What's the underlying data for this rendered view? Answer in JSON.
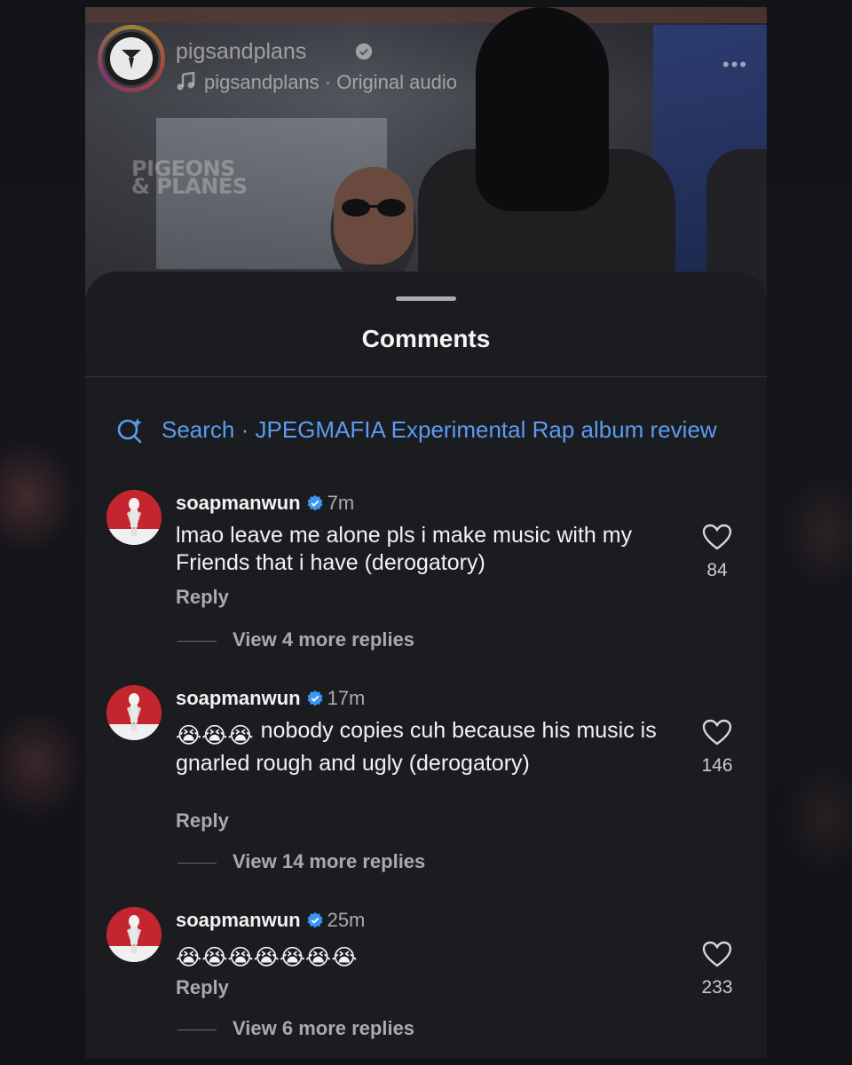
{
  "video": {
    "account": "pigsandplans",
    "audio": "pigsandplans · Original audio",
    "watermark_line1": "PIGEONS",
    "watermark_line2": "& PLANES",
    "more": "•••"
  },
  "sheet": {
    "title": "Comments",
    "search_prefix": "Search",
    "search_separator": " · ",
    "search_query": "JPEGMAFIA Experimental Rap album review"
  },
  "comments": [
    {
      "username": "soapmanwun",
      "time": "7m",
      "text": "lmao leave me alone pls i make music with my Friends that i have (derogatory)",
      "reply": "Reply",
      "view_replies": "View 4 more replies",
      "likes": "84"
    },
    {
      "username": "soapmanwun",
      "time": "17m",
      "emojis": "😭😭😭",
      "text": "nobody copies cuh because his music is gnarled rough and ugly (derogatory)",
      "reply": "Reply",
      "view_replies": "View 14 more replies",
      "likes": "146"
    },
    {
      "username": "soapmanwun",
      "time": "25m",
      "emojis": "😭😭😭😭😭😭😭",
      "reply": "Reply",
      "view_replies": "View 6 more replies",
      "likes": "233"
    }
  ],
  "colors": {
    "accent_blue": "#5b9bf0",
    "verified_blue": "#3b97f3",
    "sheet_bg": "#1b1c20"
  }
}
